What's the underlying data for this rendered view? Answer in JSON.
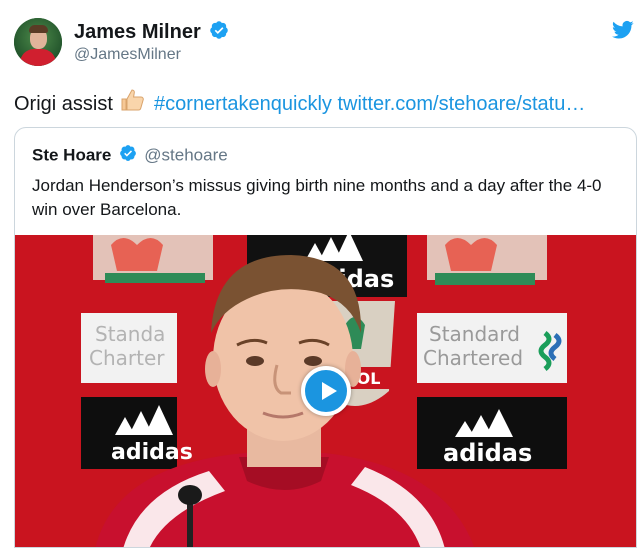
{
  "tweet": {
    "author": {
      "name": "James Milner",
      "handle": "@JamesMilner",
      "verified_icon": "verified-badge-icon",
      "avatar": "avatar-photo"
    },
    "platform_icon": "twitter-bird-icon",
    "text": {
      "prefix": "Origi assist",
      "emoji": "thumbs-up-icon",
      "hashtag": "#cornertakenquickly",
      "link": "twitter.com/stehoare/statu…"
    }
  },
  "quoted_tweet": {
    "author": {
      "name": "Ste Hoare",
      "handle": "@stehoare"
    },
    "text": "Jordan Henderson’s missus giving birth nine months and a day after the 4-0 win over Barcelona.",
    "media": {
      "type": "video",
      "backdrop_brands": [
        "adidas",
        "Standard Chartered",
        "LFC crest"
      ],
      "backdrop_text": {
        "adidas_left": "adidas",
        "adidas_right": "adidas",
        "adidas_top": "adidas",
        "sc_left_1": "Standa",
        "sc_left_2": "Charter",
        "sc_right_1": "Standard",
        "sc_right_2": "Chartered",
        "crest_text": "OOL"
      },
      "play_icon": "play-icon"
    }
  },
  "colors": {
    "link": "#1b95e0",
    "text": "#14171a",
    "secondary": "#657786",
    "border": "#ccd6dd",
    "backdrop_red": "#c9141f"
  }
}
